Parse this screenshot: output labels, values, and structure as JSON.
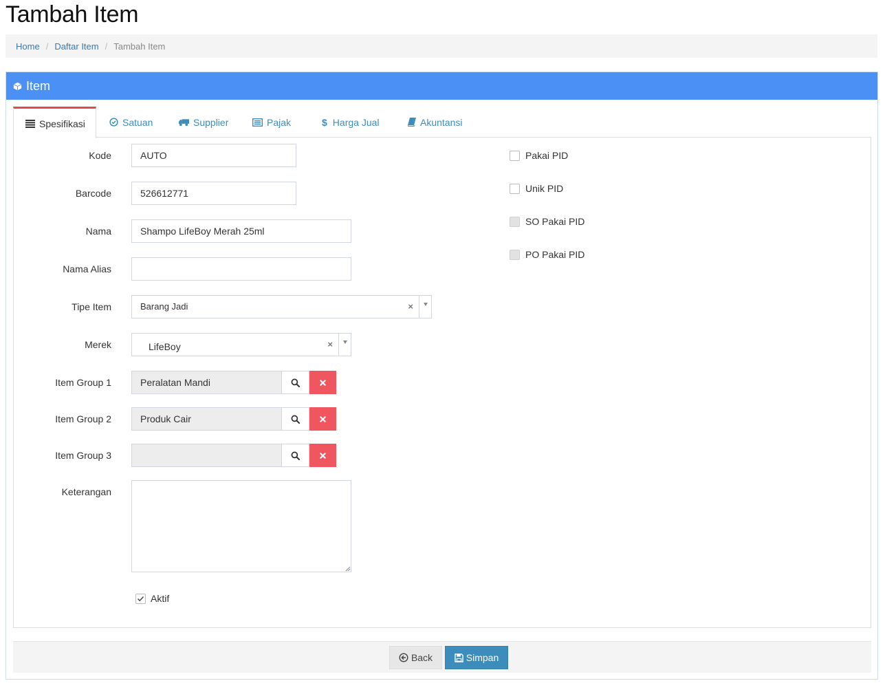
{
  "page": {
    "title": "Tambah Item"
  },
  "breadcrumb": {
    "home": "Home",
    "list": "Daftar Item",
    "current": "Tambah Item",
    "separator": "/"
  },
  "box": {
    "title": "Item"
  },
  "tabs": [
    {
      "label": "Spesifikasi",
      "icon": "list-icon",
      "active": true
    },
    {
      "label": "Satuan",
      "icon": "check-circle-icon"
    },
    {
      "label": "Supplier",
      "icon": "truck-icon"
    },
    {
      "label": "Pajak",
      "icon": "list-alt-icon"
    },
    {
      "label": "Harga Jual",
      "icon": "dollar-icon"
    },
    {
      "label": "Akuntansi",
      "icon": "book-icon"
    }
  ],
  "form": {
    "kode": {
      "label": "Kode",
      "value": "AUTO"
    },
    "barcode": {
      "label": "Barcode",
      "value": "526612771"
    },
    "nama": {
      "label": "Nama",
      "value": "Shampo LifeBoy Merah 25ml"
    },
    "nama_alias": {
      "label": "Nama Alias",
      "value": ""
    },
    "tipe_item": {
      "label": "Tipe Item",
      "value": "Barang Jadi",
      "clear": "×"
    },
    "merek": {
      "label": "Merek",
      "value": "LifeBoy",
      "clear": "×"
    },
    "item_group_1": {
      "label": "Item Group 1",
      "value": "Peralatan Mandi"
    },
    "item_group_2": {
      "label": "Item Group 2",
      "value": "Produk Cair"
    },
    "item_group_3": {
      "label": "Item Group 3",
      "value": ""
    },
    "keterangan": {
      "label": "Keterangan",
      "value": ""
    },
    "aktif": {
      "label": "Aktif",
      "checked": true
    }
  },
  "pid_options": [
    {
      "label": "Pakai PID",
      "checked": false,
      "disabled": false
    },
    {
      "label": "Unik PID",
      "checked": false,
      "disabled": false
    },
    {
      "label": "SO Pakai PID",
      "checked": false,
      "disabled": true
    },
    {
      "label": "PO Pakai PID",
      "checked": false,
      "disabled": true
    }
  ],
  "footer": {
    "back_label": "Back",
    "save_label": "Simpan"
  },
  "colors": {
    "header_blue": "#4a90f5",
    "link_blue": "#3c8dbc",
    "danger_red": "#f05660",
    "active_tab_border": "#e04a4a",
    "primary_button": "#3c8dbc"
  }
}
